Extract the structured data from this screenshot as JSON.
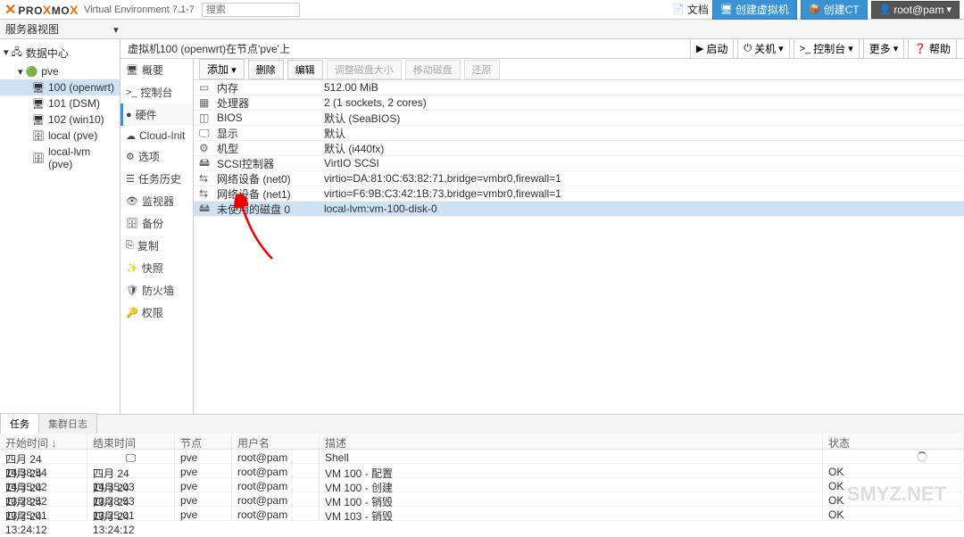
{
  "header": {
    "logo_prefix": "PRO",
    "logo_suffix": "MO",
    "ve": "Virtual Environment 7.1-7",
    "search_placeholder": "搜索",
    "docs": "文档",
    "create_vm": "创建虚拟机",
    "create_ct": "创建CT",
    "user": "root@pam"
  },
  "view_selector": "服务器视图",
  "tree": {
    "datacenter": "数据中心",
    "nodes": [
      {
        "label": "pve",
        "type": "node"
      },
      {
        "label": "100 (openwrt)",
        "type": "vm",
        "selected": true
      },
      {
        "label": "101 (DSM)",
        "type": "vm"
      },
      {
        "label": "102 (win10)",
        "type": "vm"
      },
      {
        "label": "local (pve)",
        "type": "storage"
      },
      {
        "label": "local-lvm (pve)",
        "type": "storage"
      }
    ]
  },
  "breadcrumb": "虚拟机100 (openwrt)在节点'pve'上",
  "actions": {
    "start": "启动",
    "shutdown": "关机",
    "console": "控制台",
    "more": "更多",
    "help": "帮助"
  },
  "subnav": {
    "items": [
      {
        "icon": "overview",
        "label": "概要"
      },
      {
        "icon": "console",
        "label": "控制台"
      },
      {
        "icon": "hardware",
        "label": "硬件",
        "active": true
      },
      {
        "icon": "cloud",
        "label": "Cloud-Init"
      },
      {
        "icon": "options",
        "label": "选项"
      },
      {
        "icon": "history",
        "label": "任务历史"
      },
      {
        "icon": "monitor",
        "label": "监视器"
      },
      {
        "icon": "backup",
        "label": "备份"
      },
      {
        "icon": "replication",
        "label": "复制"
      },
      {
        "icon": "snapshot",
        "label": "快照"
      },
      {
        "icon": "firewall",
        "label": "防火墙"
      },
      {
        "icon": "permissions",
        "label": "权限"
      }
    ]
  },
  "toolbar": {
    "add": "添加",
    "delete": "删除",
    "edit": "编辑",
    "resize": "调整磁盘大小",
    "move": "移动磁盘",
    "restore": "还原"
  },
  "hardware": [
    {
      "icon": "mem",
      "name": "内存",
      "val": "512.00 MiB"
    },
    {
      "icon": "cpu",
      "name": "处理器",
      "val": "2 (1 sockets, 2 cores)"
    },
    {
      "icon": "bios",
      "name": "BIOS",
      "val": "默认 (SeaBIOS)"
    },
    {
      "icon": "display",
      "name": "显示",
      "val": "默认"
    },
    {
      "icon": "machine",
      "name": "机型",
      "val": "默认 (i440fx)"
    },
    {
      "icon": "scsi",
      "name": "SCSI控制器",
      "val": "VirtIO SCSI"
    },
    {
      "icon": "net",
      "name": "网络设备 (net0)",
      "val": "virtio=DA:81:0C:63:82:71,bridge=vmbr0,firewall=1"
    },
    {
      "icon": "net",
      "name": "网络设备 (net1)",
      "val": "virtio=F6:9B:C3:42:1B:73,bridge=vmbr0,firewall=1"
    },
    {
      "icon": "hdd",
      "name": "未使用的磁盘 0",
      "val": "local-lvm:vm-100-disk-0",
      "selected": true
    }
  ],
  "bottom_tabs": {
    "tasks": "任务",
    "cluster_log": "集群日志"
  },
  "task_head": {
    "start": "开始时间 ↓",
    "end": "结束时间",
    "node": "节点",
    "user": "用户名",
    "desc": "描述",
    "status": "状态"
  },
  "tasks": [
    {
      "start": "四月 24 14:38:54",
      "end": "",
      "node": "pve",
      "user": "root@pam",
      "desc": "Shell",
      "status": "spinner"
    },
    {
      "start": "四月 24 14:35:02",
      "end": "四月 24 14:35:03",
      "node": "pve",
      "user": "root@pam",
      "desc": "VM 100 - 配置",
      "status": "OK"
    },
    {
      "start": "四月 24 13:28:52",
      "end": "四月 24 13:28:53",
      "node": "pve",
      "user": "root@pam",
      "desc": "VM 100 - 创建",
      "status": "OK"
    },
    {
      "start": "四月 24 13:25:01",
      "end": "四月 24 13:25:01",
      "node": "pve",
      "user": "root@pam",
      "desc": "VM 100 - 销毁",
      "status": "OK"
    },
    {
      "start": "四月 24 13:24:12",
      "end": "四月 24 13:24:12",
      "node": "pve",
      "user": "root@pam",
      "desc": "VM 103 - 销毁",
      "status": "OK"
    }
  ],
  "watermark": "SMYZ.NET"
}
